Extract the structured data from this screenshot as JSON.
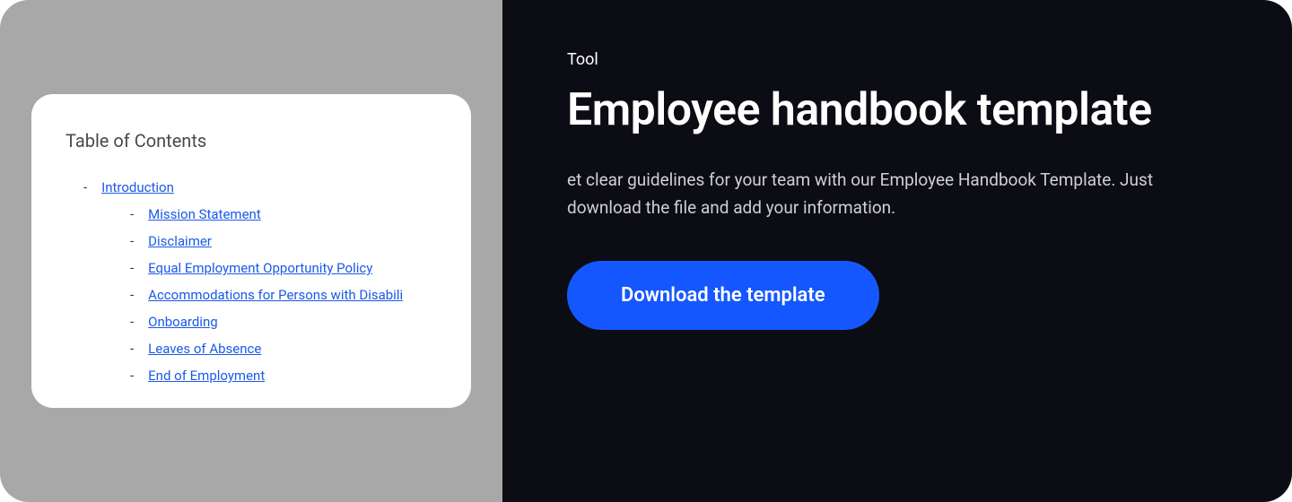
{
  "preview": {
    "heading": "Table of Contents",
    "root_item": "Introduction",
    "sub_items": [
      "Mission Statement",
      "Disclaimer",
      "Equal Employment Opportunity Policy",
      "Accommodations for Persons with Disabili",
      "Onboarding",
      "Leaves of Absence ",
      "End of Employment"
    ]
  },
  "card": {
    "eyebrow": "Tool",
    "title": "Employee handbook template",
    "description": "et clear guidelines for your team with our Employee Handbook Template. Just download the file and add your information.",
    "cta_label": "Download the template"
  },
  "colors": {
    "panel_bg": "#a8a8a8",
    "dark_bg": "#0b0c14",
    "accent": "#1557ff",
    "link": "#1a5ae8"
  }
}
